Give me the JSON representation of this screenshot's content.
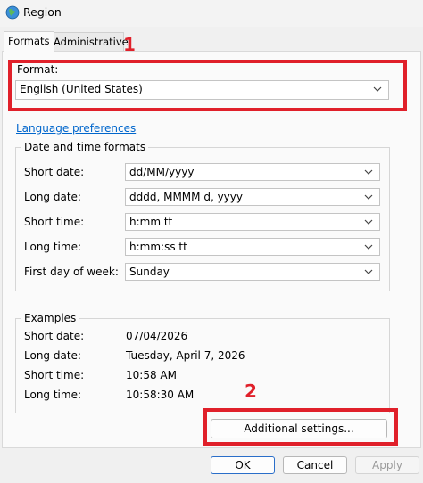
{
  "window": {
    "title": "Region",
    "icon": "globe-icon"
  },
  "tabs": [
    {
      "label": "Formats",
      "active": true
    },
    {
      "label": "Administrative",
      "active": false
    }
  ],
  "annotations": {
    "marker_1": "1",
    "marker_2": "2",
    "color": "#e0202a"
  },
  "format": {
    "label": "Format:",
    "value": "English (United States)"
  },
  "links": {
    "language_preferences": "Language preferences"
  },
  "date_time_formats": {
    "title": "Date and time formats",
    "rows": [
      {
        "label": "Short date:",
        "value": "dd/MM/yyyy"
      },
      {
        "label": "Long date:",
        "value": "dddd, MMMM d, yyyy"
      },
      {
        "label": "Short time:",
        "value": "h:mm tt"
      },
      {
        "label": "Long time:",
        "value": "h:mm:ss tt"
      },
      {
        "label": "First day of week:",
        "value": "Sunday"
      }
    ]
  },
  "examples": {
    "title": "Examples",
    "rows": [
      {
        "label": "Short date:",
        "value": "07/04/2026"
      },
      {
        "label": "Long date:",
        "value": "Tuesday, April 7, 2026"
      },
      {
        "label": "Short time:",
        "value": "10:58 AM"
      },
      {
        "label": "Long time:",
        "value": "10:58:30 AM"
      }
    ]
  },
  "buttons": {
    "additional": "Additional settings...",
    "ok": "OK",
    "cancel": "Cancel",
    "apply": "Apply"
  },
  "colors": {
    "link": "#0066cc",
    "accent": "#2a6ec9"
  }
}
